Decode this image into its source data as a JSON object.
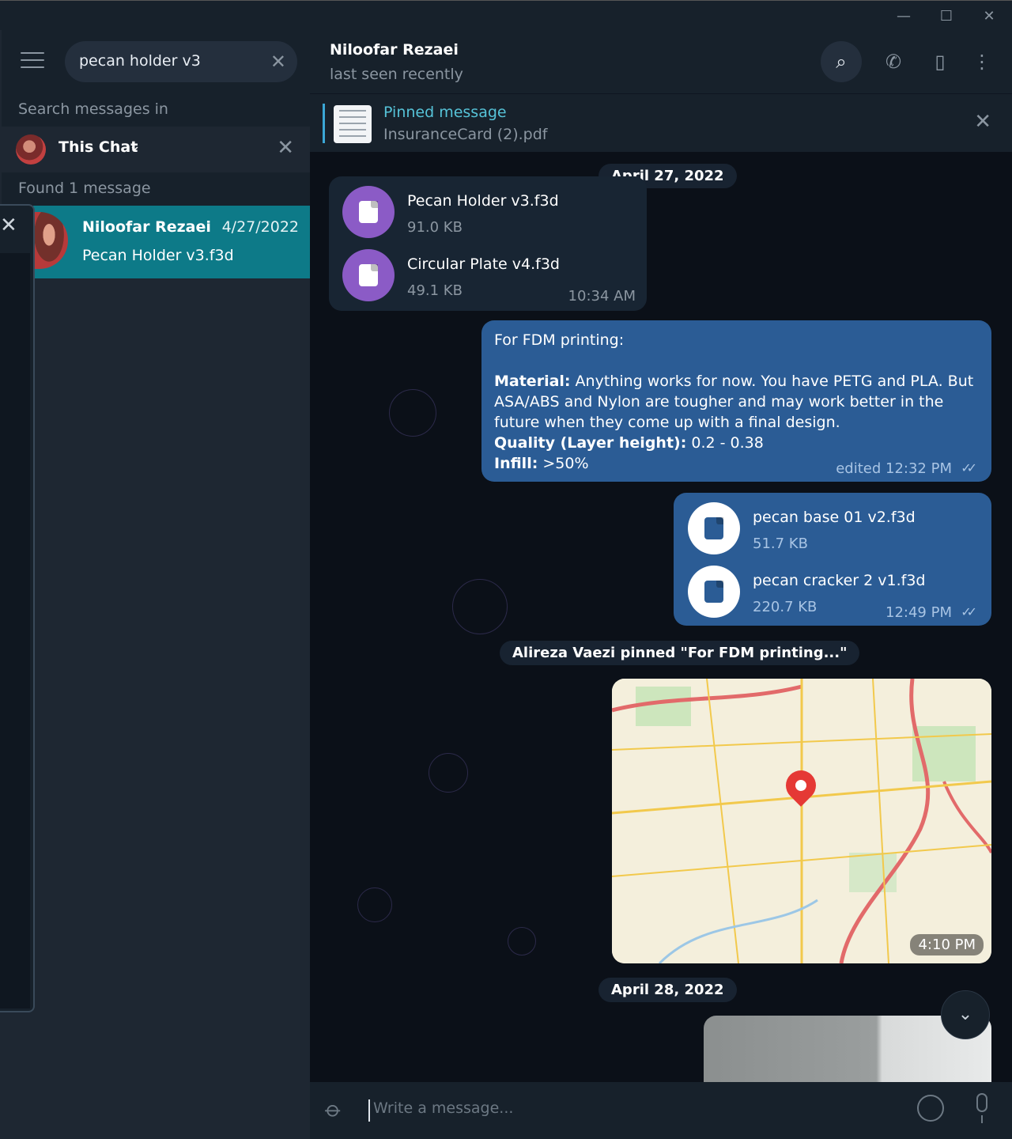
{
  "window": {
    "minimize": "—",
    "maximize": "☐",
    "close": "✕"
  },
  "sidebar": {
    "search_value": "pecan holder v3",
    "search_in_label": "Search messages in",
    "chat_filter": "This Chat",
    "found_label": "Found 1 message",
    "result": {
      "name": "Niloofar Rezaei",
      "date": "4/27/2022",
      "message": "Pecan Holder v3.f3d"
    }
  },
  "chat": {
    "name": "Niloofar Rezaei",
    "status": "last seen recently",
    "pinned": {
      "title": "Pinned message",
      "file": "InsuranceCard (2).pdf"
    },
    "date1": "April 27, 2022",
    "incoming_files": [
      {
        "name": "Pecan Holder v3.f3d",
        "size": "91.0 KB"
      },
      {
        "name": "Circular Plate v4.f3d",
        "size": "49.1 KB"
      }
    ],
    "incoming_time": "10:34 AM",
    "text_message": {
      "line1": "For FDM printing:",
      "material_label": "Material:",
      "material_text": " Anything works for now. You have PETG and PLA. But ASA/ABS and Nylon are tougher and may work better in the future when they come up with a final design.",
      "quality_label": "Quality (Layer height):",
      "quality_text": " 0.2 - 0.38",
      "infill_label": "Infill:",
      "infill_text": " >50%",
      "time": "edited 12:32 PM"
    },
    "outgoing_files": [
      {
        "name": "pecan base 01 v2.f3d",
        "size": "51.7 KB"
      },
      {
        "name": "pecan cracker 2 v1.f3d",
        "size": "220.7 KB"
      }
    ],
    "outgoing_time": "12:49 PM",
    "service_message": "Alireza Vaezi pinned \"For FDM printing...\"",
    "map_time": "4:10 PM",
    "date2": "April 28, 2022",
    "composer_placeholder": "Write a message..."
  },
  "colors": {
    "accent": "#56c3d8",
    "outgoing_bubble": "#2b5c95",
    "incoming_bubble": "#182533",
    "selected_result": "#0d7a88",
    "file_icon": "#8b5bc6"
  }
}
